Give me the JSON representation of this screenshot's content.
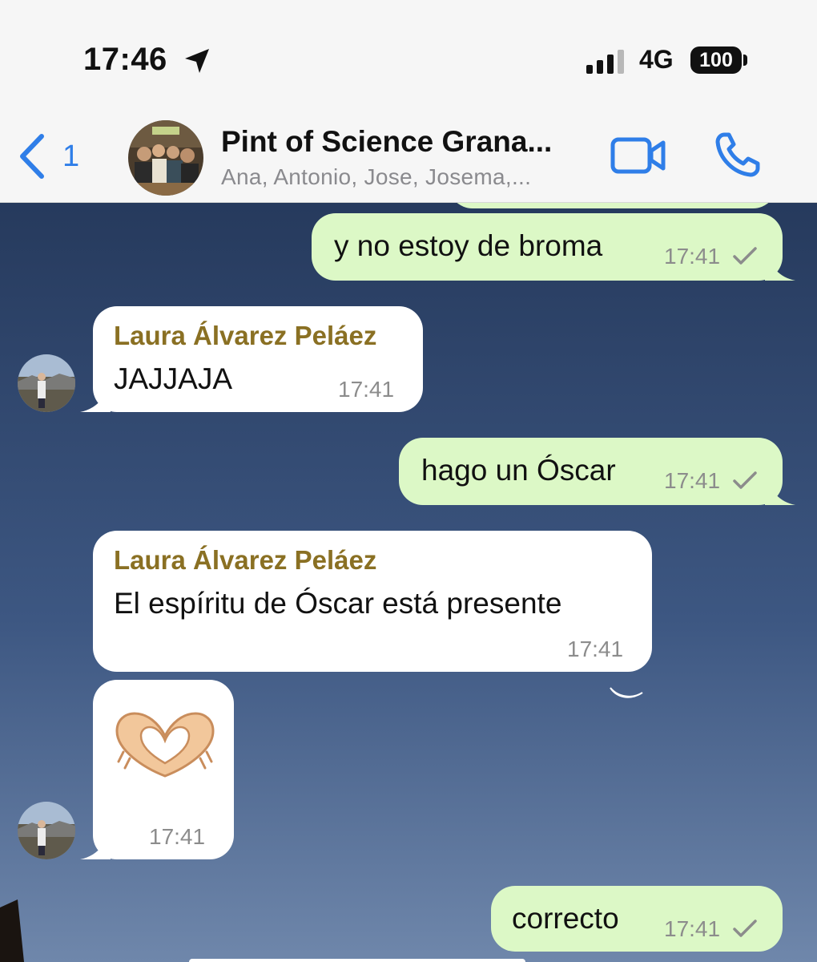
{
  "status_bar": {
    "time": "17:46",
    "network": "4G",
    "battery": "100"
  },
  "header": {
    "back_count": "1",
    "title": "Pint of Science Grana...",
    "subtitle": "Ana, Antonio, Jose, Josema,..."
  },
  "messages": [
    {
      "direction": "outgoing",
      "text": "y no estoy de broma",
      "time": "17:41",
      "status": "sent"
    },
    {
      "direction": "incoming",
      "sender": "Laura Álvarez Peláez",
      "text": "JAJJAJA",
      "time": "17:41"
    },
    {
      "direction": "outgoing",
      "text": "hago un Óscar",
      "time": "17:41",
      "status": "sent"
    },
    {
      "direction": "incoming",
      "sender": "Laura Álvarez Peláez",
      "text": "El espíritu de Óscar está presente",
      "time": "17:41"
    },
    {
      "direction": "incoming",
      "emoji": "heart-hands",
      "time": "17:41"
    },
    {
      "direction": "outgoing",
      "text": "correcto",
      "time": "17:41",
      "status": "sent"
    }
  ],
  "colors": {
    "accent": "#2f7ee8",
    "outgoing_bubble": "#dcf8c6",
    "incoming_bubble": "#ffffff",
    "sender_name": "#8a7023"
  }
}
